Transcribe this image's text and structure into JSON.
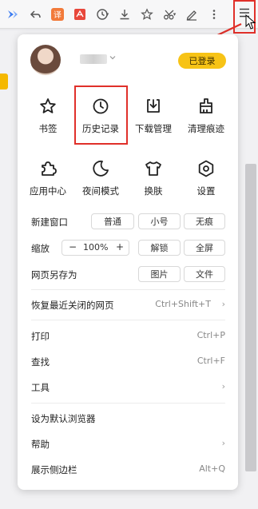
{
  "toolbar": {
    "icons": [
      "blue-logo-icon",
      "back-arrow-icon",
      "translate-icon",
      "pdf-icon",
      "history-clock-icon",
      "download-icon",
      "favorite-star-icon",
      "screenshot-scissors-icon",
      "edit-pen-icon",
      "more-vertical-icon",
      "hamburger-menu-icon"
    ],
    "translate_glyph": "译"
  },
  "user": {
    "status_badge": "已登录"
  },
  "quick_grid": [
    {
      "label": "书签",
      "icon": "star-icon"
    },
    {
      "label": "历史记录",
      "icon": "clock-icon"
    },
    {
      "label": "下载管理",
      "icon": "download-box-icon"
    },
    {
      "label": "清理痕迹",
      "icon": "broom-icon"
    },
    {
      "label": "应用中心",
      "icon": "puzzle-icon"
    },
    {
      "label": "夜间模式",
      "icon": "moon-icon"
    },
    {
      "label": "换肤",
      "icon": "shirt-icon"
    },
    {
      "label": "设置",
      "icon": "gear-icon"
    }
  ],
  "window_row": {
    "label": "新建窗口",
    "options": [
      "普通",
      "小号",
      "无痕"
    ]
  },
  "zoom_row": {
    "label": "缩放",
    "minus": "−",
    "value": "100%",
    "plus": "+",
    "unlock": "解锁",
    "fullscreen": "全屏"
  },
  "save_row": {
    "label": "网页另存为",
    "options": [
      "图片",
      "文件"
    ]
  },
  "menu_items": [
    {
      "label": "恢复最近关闭的网页",
      "shortcut": "Ctrl+Shift+T",
      "arrow": "›"
    },
    {
      "label": "打印",
      "shortcut": "Ctrl+P",
      "arrow": ""
    },
    {
      "label": "查找",
      "shortcut": "Ctrl+F",
      "arrow": ""
    },
    {
      "label": "工具",
      "shortcut": "",
      "arrow": "›"
    },
    {
      "label": "设为默认浏览器",
      "shortcut": "",
      "arrow": ""
    },
    {
      "label": "帮助",
      "shortcut": "",
      "arrow": "›"
    },
    {
      "label": "展示侧边栏",
      "shortcut": "Alt+Q",
      "arrow": ""
    }
  ],
  "colors": {
    "accent_badge": "#f7c316",
    "annotation_red": "#e0302a"
  }
}
